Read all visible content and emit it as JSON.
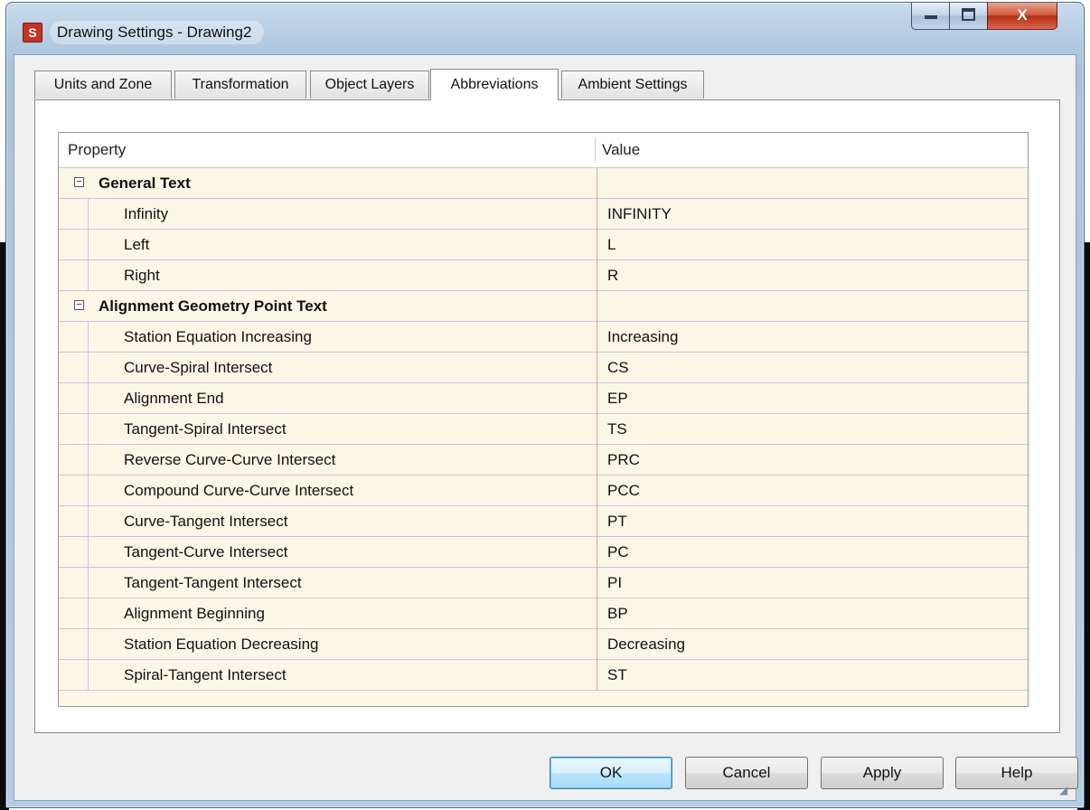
{
  "window": {
    "title": "Drawing Settings - Drawing2",
    "app_icon_glyph": "S",
    "controls": {
      "close_glyph": "X"
    }
  },
  "tabs": [
    {
      "label": "Units and Zone",
      "active": false
    },
    {
      "label": "Transformation",
      "active": false
    },
    {
      "label": "Object Layers",
      "active": false
    },
    {
      "label": "Abbreviations",
      "active": true
    },
    {
      "label": "Ambient Settings",
      "active": false
    }
  ],
  "grid": {
    "header": {
      "property": "Property",
      "value": "Value"
    },
    "categories": [
      {
        "name": "General Text",
        "expander": "−",
        "items": [
          {
            "property": "Infinity",
            "value": "INFINITY"
          },
          {
            "property": "Left",
            "value": "L"
          },
          {
            "property": "Right",
            "value": "R"
          }
        ]
      },
      {
        "name": "Alignment Geometry Point Text",
        "expander": "−",
        "items": [
          {
            "property": "Station Equation Increasing",
            "value": "Increasing"
          },
          {
            "property": "Curve-Spiral Intersect",
            "value": "CS"
          },
          {
            "property": "Alignment End",
            "value": "EP"
          },
          {
            "property": "Tangent-Spiral Intersect",
            "value": "TS"
          },
          {
            "property": "Reverse Curve-Curve Intersect",
            "value": "PRC"
          },
          {
            "property": "Compound Curve-Curve Intersect",
            "value": "PCC"
          },
          {
            "property": "Curve-Tangent Intersect",
            "value": "PT"
          },
          {
            "property": "Tangent-Curve Intersect",
            "value": "PC"
          },
          {
            "property": "Tangent-Tangent Intersect",
            "value": "PI"
          },
          {
            "property": "Alignment Beginning",
            "value": "BP"
          },
          {
            "property": "Station Equation Decreasing",
            "value": "Decreasing"
          },
          {
            "property": "Spiral-Tangent Intersect",
            "value": "ST"
          }
        ]
      }
    ]
  },
  "buttons": {
    "ok": "OK",
    "cancel": "Cancel",
    "apply": "Apply",
    "help": "Help"
  },
  "colors": {
    "grid_bg": "#fbf7e6",
    "row_line": "#d2bfe0",
    "value_sep": "#e8a0a0",
    "title_gradient": "#b4cbe2",
    "close_button": "#c8422a"
  }
}
